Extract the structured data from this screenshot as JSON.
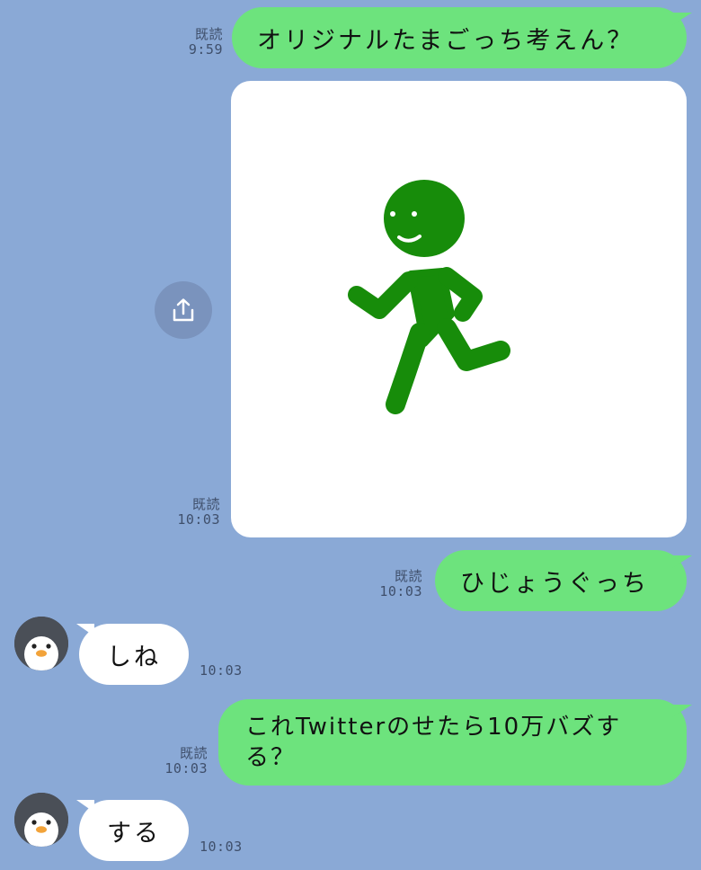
{
  "messages": {
    "m1": {
      "text": "オリジナルたまごっち考えん？",
      "status": "既読",
      "time": "9:59"
    },
    "m2": {
      "status": "既読",
      "time": "10:03",
      "image_alt": "walking green stick figure"
    },
    "m3": {
      "text": "ひじょうぐっち",
      "status": "既読",
      "time": "10:03"
    },
    "m4": {
      "text": "しね",
      "time": "10:03"
    },
    "m5": {
      "line1": "これTwitterのせたら10万バズす",
      "line2": "る？",
      "status": "既読",
      "time": "10:03"
    },
    "m6": {
      "text": "する",
      "time": "10:03"
    }
  },
  "icons": {
    "share": "share-upload-icon",
    "avatar": "penguin-avatar-icon"
  },
  "colors": {
    "background": "#8aa9d6",
    "outgoing_bubble": "#6de37d",
    "incoming_bubble": "#ffffff",
    "figure": "#178c0a"
  }
}
